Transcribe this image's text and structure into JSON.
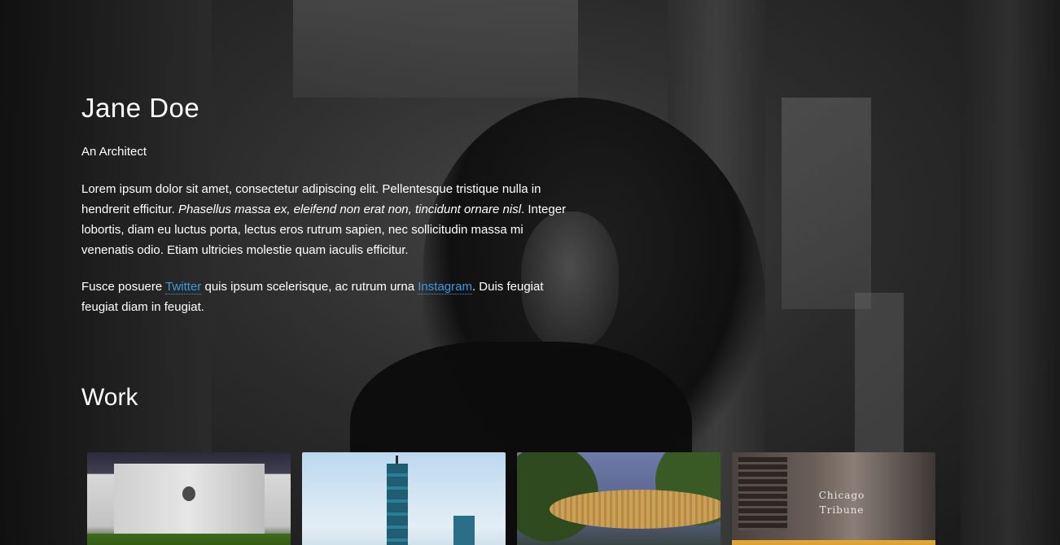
{
  "profile": {
    "name": "Jane Doe",
    "role": "An Architect"
  },
  "intro": {
    "p1_start": "Lorem ipsum dolor sit amet, consectetur adipiscing elit. Pellentesque tristique nulla in hendrerit efficitur. ",
    "p1_em": "Phasellus massa ex, eleifend non erat non, tincidunt ornare nisl",
    "p1_end": ". Integer lobortis, diam eu luctus porta, lectus eros rutrum sapien, nec sollicitudin massa mi venenatis odio. Etiam ultricies molestie quam iaculis efficitur.",
    "p2_start": "Fusce posuere ",
    "link_twitter": "Twitter",
    "p2_mid": " quis ipsum scelerisque, ac rutrum urna ",
    "link_instagram": "Instagram",
    "p2_end": ". Duis feugiat feugiat diam in feugiat."
  },
  "work": {
    "title": "Work",
    "thumbnail_sign_text": "Chicago Tribune"
  },
  "colors": {
    "link": "#3b9be0",
    "text": "#ffffff"
  }
}
